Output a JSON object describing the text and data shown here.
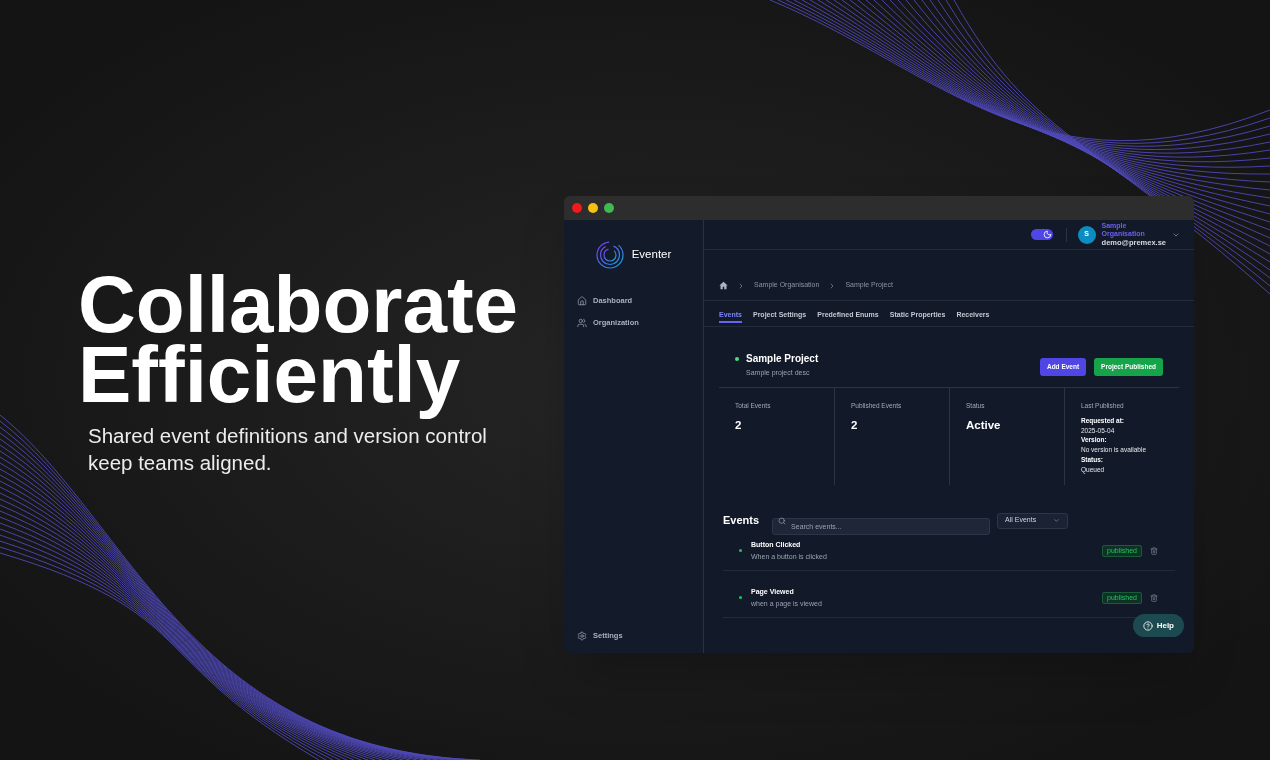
{
  "hero": {
    "title": "Collaborate Efficiently",
    "subtitle": "Shared event definitions and version control keep teams aligned."
  },
  "window": {
    "sidebar": {
      "logo": "Eventer",
      "items": [
        {
          "label": "Dashboard",
          "selected": false
        },
        {
          "label": "Organization",
          "selected": false
        }
      ],
      "footer_item": {
        "label": "Settings"
      }
    },
    "topbar": {
      "theme_toggle": {
        "on": true
      },
      "user": {
        "initial": "S",
        "organisation": "Sample Organisation",
        "email": "demo@premex.se"
      }
    },
    "breadcrumb": [
      "Sample Organisation",
      "Sample Project"
    ],
    "tabs": [
      {
        "label": "Events",
        "selected": true
      },
      {
        "label": "Project Settings",
        "selected": false
      },
      {
        "label": "Predefined Enums",
        "selected": false
      },
      {
        "label": "Static Properties",
        "selected": false
      },
      {
        "label": "Receivers",
        "selected": false
      }
    ],
    "project": {
      "name": "Sample Project",
      "description": "Sample project desc",
      "buttons": [
        {
          "label": "Add Event",
          "kind": "primary"
        },
        {
          "label": "Project Published",
          "kind": "success"
        }
      ]
    },
    "stats": [
      {
        "kind": "value",
        "label": "Total Events",
        "value": "2"
      },
      {
        "kind": "value",
        "label": "Published Events",
        "value": "2"
      },
      {
        "kind": "value",
        "label": "Status",
        "value": "Active"
      },
      {
        "kind": "details",
        "label": "Last Published",
        "fields": [
          {
            "label": "Requested at:",
            "value": "2025-05-04"
          },
          {
            "label": "Version:",
            "value": "No version is available"
          },
          {
            "label": "Status:",
            "value": "Queued"
          }
        ]
      }
    ],
    "events": {
      "title": "Events",
      "search": {
        "placeholder": "Search events..."
      },
      "filter": {
        "value": "All Events"
      },
      "items": [
        {
          "name": "Button Clicked",
          "description": "When a button is clicked",
          "status": "published"
        },
        {
          "name": "Page Viewed",
          "description": "when a page is viewed",
          "status": "published"
        }
      ]
    },
    "help_button": {
      "label": "Help"
    }
  }
}
